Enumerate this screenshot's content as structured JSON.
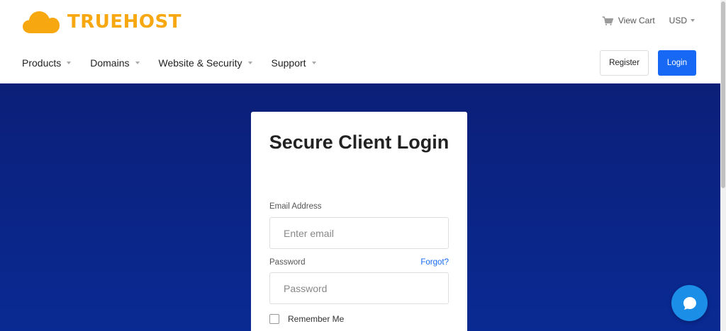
{
  "brand": {
    "name": "TRUEHOST",
    "color": "#f7a70f",
    "icon": "cloud-icon"
  },
  "topbar": {
    "cart_label": "View Cart",
    "cart_icon": "cart-icon",
    "currency": "USD"
  },
  "nav": {
    "items": [
      {
        "label": "Products"
      },
      {
        "label": "Domains"
      },
      {
        "label": "Website & Security"
      },
      {
        "label": "Support"
      }
    ]
  },
  "auth": {
    "register_label": "Register",
    "login_label": "Login"
  },
  "login_card": {
    "title": "Secure Client Login",
    "email_label": "Email Address",
    "email_placeholder": "Enter email",
    "email_value": "",
    "password_label": "Password",
    "forgot_label": "Forgot?",
    "password_placeholder": "Password",
    "password_value": "",
    "remember_label": "Remember Me"
  },
  "colors": {
    "primary": "#1769f5",
    "hero": "#0a2a93",
    "chat": "#1b8ee8"
  },
  "chat": {
    "icon": "chat-bubble-icon"
  }
}
